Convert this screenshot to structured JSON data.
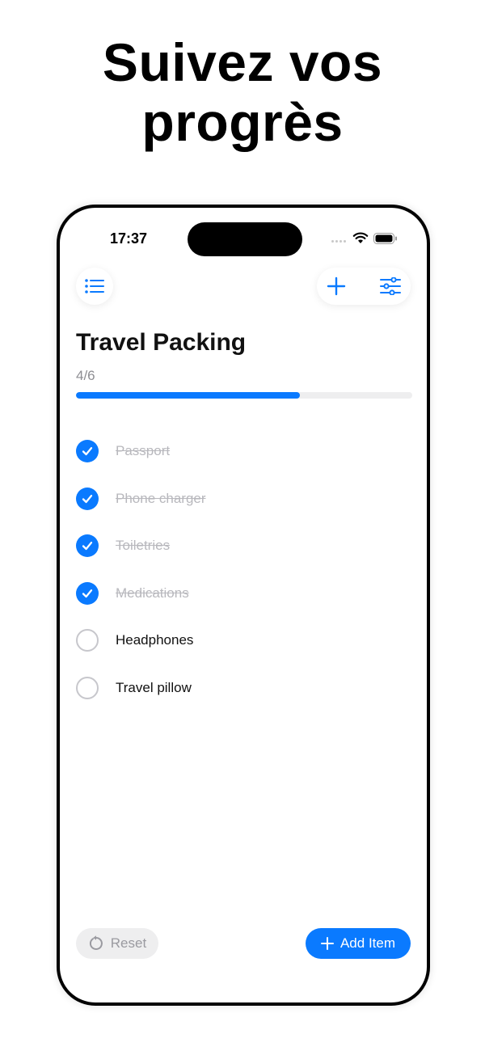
{
  "headline": {
    "line1": "Suivez vos",
    "line2": "progrès"
  },
  "status_bar": {
    "time": "17:37",
    "icons": [
      "signal-dots-icon",
      "wifi-icon",
      "battery-icon"
    ]
  },
  "toolbar": {
    "left_icon": "list-icon",
    "right_icons": [
      "plus-icon",
      "sliders-icon"
    ]
  },
  "list": {
    "title": "Travel Packing",
    "count_label": "4/6",
    "progress": 0.667,
    "items": [
      {
        "label": "Passport",
        "checked": true
      },
      {
        "label": "Phone charger",
        "checked": true
      },
      {
        "label": "Toiletries",
        "checked": true
      },
      {
        "label": "Medications",
        "checked": true
      },
      {
        "label": "Headphones",
        "checked": false
      },
      {
        "label": "Travel pillow",
        "checked": false
      }
    ]
  },
  "footer": {
    "reset_label": "Reset",
    "reset_icon": "reset-arrow-icon",
    "add_label": "Add Item",
    "add_icon": "plus-icon"
  },
  "colors": {
    "accent": "#0a7aff",
    "done_text": "#b8b8bd",
    "track": "#eeeeef"
  }
}
